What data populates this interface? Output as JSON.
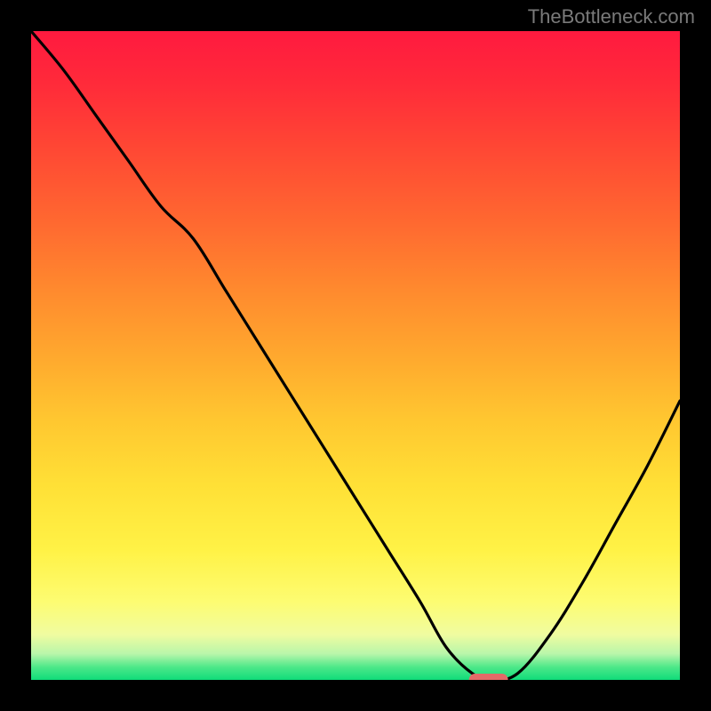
{
  "watermark": "TheBottleneck.com",
  "chart_data": {
    "type": "line",
    "title": "",
    "xlabel": "",
    "ylabel": "",
    "xlim": [
      0,
      1
    ],
    "ylim": [
      0,
      1
    ],
    "x": [
      0.0,
      0.05,
      0.1,
      0.15,
      0.2,
      0.25,
      0.3,
      0.35,
      0.4,
      0.45,
      0.5,
      0.55,
      0.6,
      0.64,
      0.68,
      0.71,
      0.75,
      0.8,
      0.85,
      0.9,
      0.95,
      1.0
    ],
    "values": [
      1.0,
      0.94,
      0.87,
      0.8,
      0.73,
      0.68,
      0.6,
      0.52,
      0.44,
      0.36,
      0.28,
      0.2,
      0.12,
      0.05,
      0.01,
      0.0,
      0.01,
      0.07,
      0.15,
      0.24,
      0.33,
      0.43
    ],
    "marker": {
      "x": 0.705,
      "y": 0.0
    },
    "background_gradient": [
      "#ff1a3f",
      "#ffe036",
      "#10dc7a"
    ]
  }
}
